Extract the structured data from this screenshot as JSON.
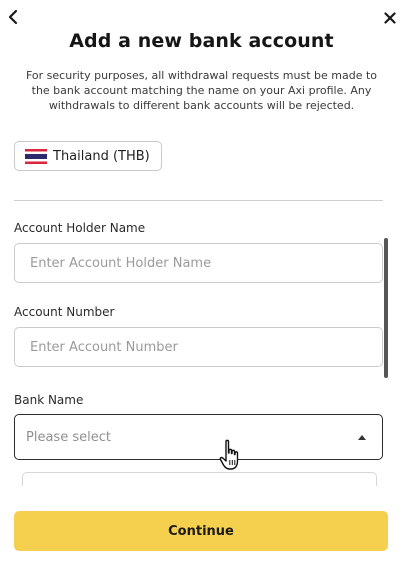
{
  "header": {
    "back_icon": "chevron-left-icon",
    "close_icon": "close-icon",
    "title": "Add a new bank account"
  },
  "notice": {
    "text": "For security purposes, all withdrawal requests must be made to the bank account matching the name on your Axi profile. Any withdrawals to different bank accounts will be rejected."
  },
  "country": {
    "flag_icon": "thailand-flag-icon",
    "label": "Thailand (THB)"
  },
  "form": {
    "account_holder": {
      "label": "Account Holder Name",
      "value": "",
      "placeholder": "Enter Account Holder Name"
    },
    "account_number": {
      "label": "Account Number",
      "value": "",
      "placeholder": "Enter Account Number"
    },
    "bank_name": {
      "label": "Bank Name",
      "placeholder": "Please select",
      "caret_icon": "caret-up-icon"
    }
  },
  "actions": {
    "continue_label": "Continue"
  },
  "colors": {
    "accent": "#f5d04e",
    "flag_red": "#d7263d",
    "flag_blue": "#2d2a6e"
  }
}
